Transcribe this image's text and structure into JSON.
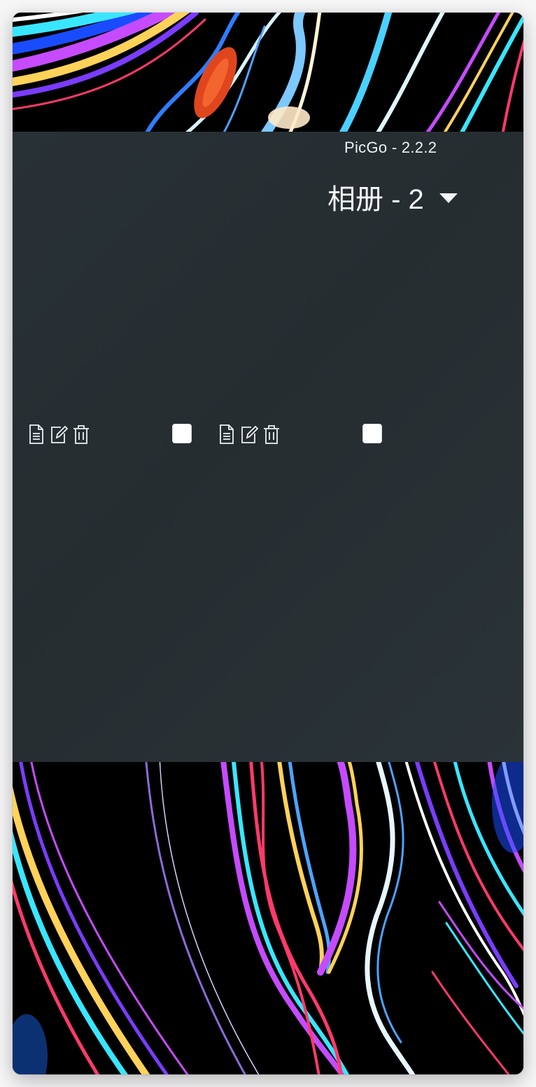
{
  "window": {
    "app_title": "PicGo - 2.2.2"
  },
  "gallery": {
    "album_title": "相册 - 2",
    "items": [
      {
        "actions": [
          {
            "name": "copy-link",
            "icon": "document-icon"
          },
          {
            "name": "edit",
            "icon": "edit-icon"
          },
          {
            "name": "delete",
            "icon": "trash-icon"
          }
        ],
        "selected": false
      },
      {
        "actions": [
          {
            "name": "copy-link",
            "icon": "document-icon"
          },
          {
            "name": "edit",
            "icon": "edit-icon"
          },
          {
            "name": "delete",
            "icon": "trash-icon"
          }
        ],
        "selected": false
      }
    ]
  },
  "colors": {
    "panel_background": "#283136",
    "text": "#eef1f3",
    "checkbox": "#ffffff",
    "wallpaper": "#000000"
  }
}
